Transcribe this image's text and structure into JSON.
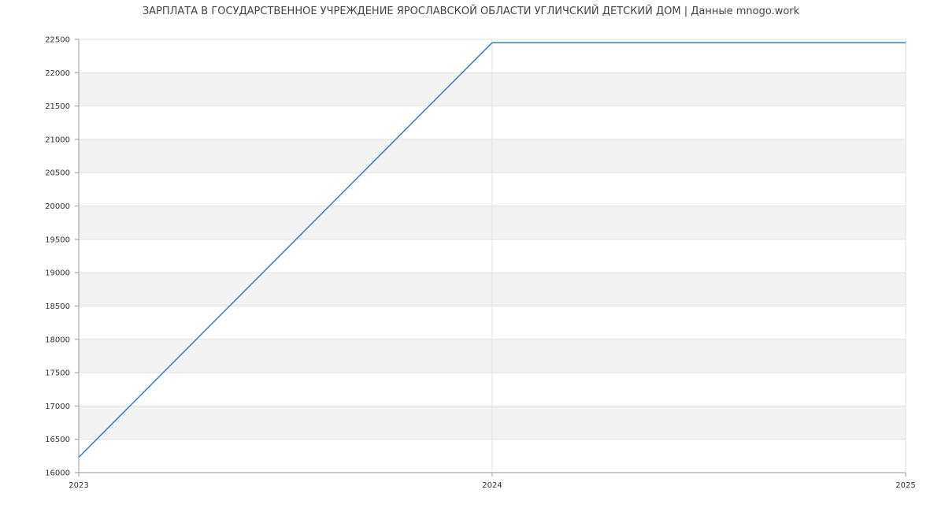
{
  "chart_data": {
    "type": "line",
    "title": "ЗАРПЛАТА В ГОСУДАРСТВЕННОЕ УЧРЕЖДЕНИЕ ЯРОСЛАВСКОЙ ОБЛАСТИ УГЛИЧСКИЙ ДЕТСКИЙ ДОМ | Данные mnogo.work",
    "xlabel": "",
    "ylabel": "",
    "x_ticks": [
      "2023",
      "2024",
      "2025"
    ],
    "xlim": [
      2023,
      2025
    ],
    "ylim": [
      16000,
      22500
    ],
    "y_ticks": [
      16000,
      16500,
      17000,
      17500,
      18000,
      18500,
      19000,
      19500,
      20000,
      20500,
      21000,
      21500,
      22000,
      22500
    ],
    "grid": true,
    "legend": "none",
    "series": [
      {
        "color": "#3a7cc2",
        "x": [
          2023,
          2024,
          2025
        ],
        "y": [
          16230,
          22450,
          22450
        ]
      }
    ],
    "colors": {
      "line": "#3a7cc2",
      "band": "#f3f3f3",
      "grid": "#e2e2e2",
      "axis": "#999999"
    }
  }
}
